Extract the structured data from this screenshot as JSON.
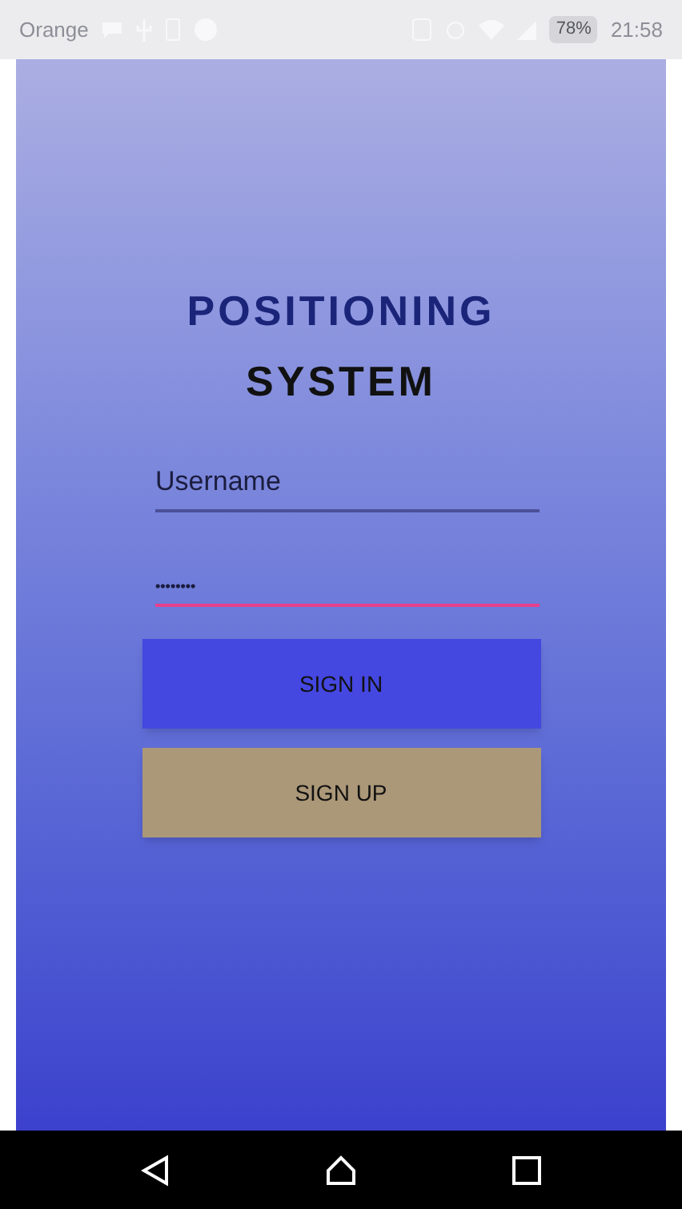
{
  "status_bar": {
    "carrier": "Orange",
    "battery": "78%",
    "time": "21:58"
  },
  "title": {
    "line_1": "POSITIONING",
    "line_2": "SYSTEM"
  },
  "fields": [
    {
      "placeholder": "Username",
      "focused": false
    },
    {
      "value": "••••••••",
      "focused": true
    }
  ],
  "buttons": [
    {
      "label": "SIGN IN",
      "kind": "primary"
    },
    {
      "label": "SIGN UP",
      "kind": "secondary"
    }
  ]
}
